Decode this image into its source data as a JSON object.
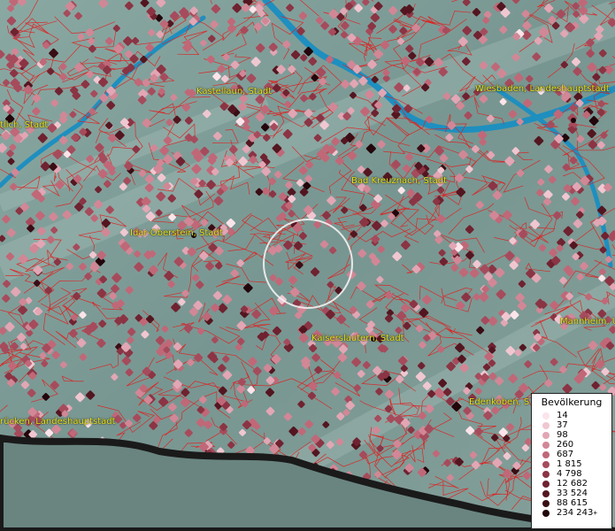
{
  "map": {
    "cities": [
      {
        "id": "kastellaun",
        "name": "Kastellaun, Stadt"
      },
      {
        "id": "wiesbaden",
        "name": "Wiesbaden, Landeshauptstadt"
      },
      {
        "id": "traben",
        "name": "tlich, Stadt"
      },
      {
        "id": "badkreuznach",
        "name": "Bad Kreuznach, Stadt"
      },
      {
        "id": "idar",
        "name": "Idar-Oberstein, Stadt"
      },
      {
        "id": "kaiserslautern",
        "name": "Kaiserslautern, Stadt"
      },
      {
        "id": "mannheim",
        "name": "Mannheim, U"
      },
      {
        "id": "edenkoben",
        "name": "Edenkoben, S"
      },
      {
        "id": "saarbruecken",
        "name": "rücken, Landeshauptstadt"
      }
    ],
    "colors": {
      "terrain": "#7f9b97",
      "river": "#1e8fbf",
      "borders": "#e01e1e",
      "coast": "#1a1a1a",
      "label": "#e7e31a"
    }
  },
  "legend": {
    "title": "Bevölkerung",
    "items": [
      {
        "label": "14",
        "color": "#fbe4ea"
      },
      {
        "label": "37",
        "color": "#f0c7d1"
      },
      {
        "label": "98",
        "color": "#e2a6b4"
      },
      {
        "label": "260",
        "color": "#d28796"
      },
      {
        "label": "687",
        "color": "#c06878"
      },
      {
        "label": "1 815",
        "color": "#a64b5c"
      },
      {
        "label": "4 798",
        "color": "#8b3444"
      },
      {
        "label": "12 682",
        "color": "#6f2230"
      },
      {
        "label": "33 524",
        "color": "#531620"
      },
      {
        "label": "88 615",
        "color": "#3a0d14"
      },
      {
        "label": "234 243",
        "color": "#22060b",
        "plus": "+"
      }
    ]
  }
}
